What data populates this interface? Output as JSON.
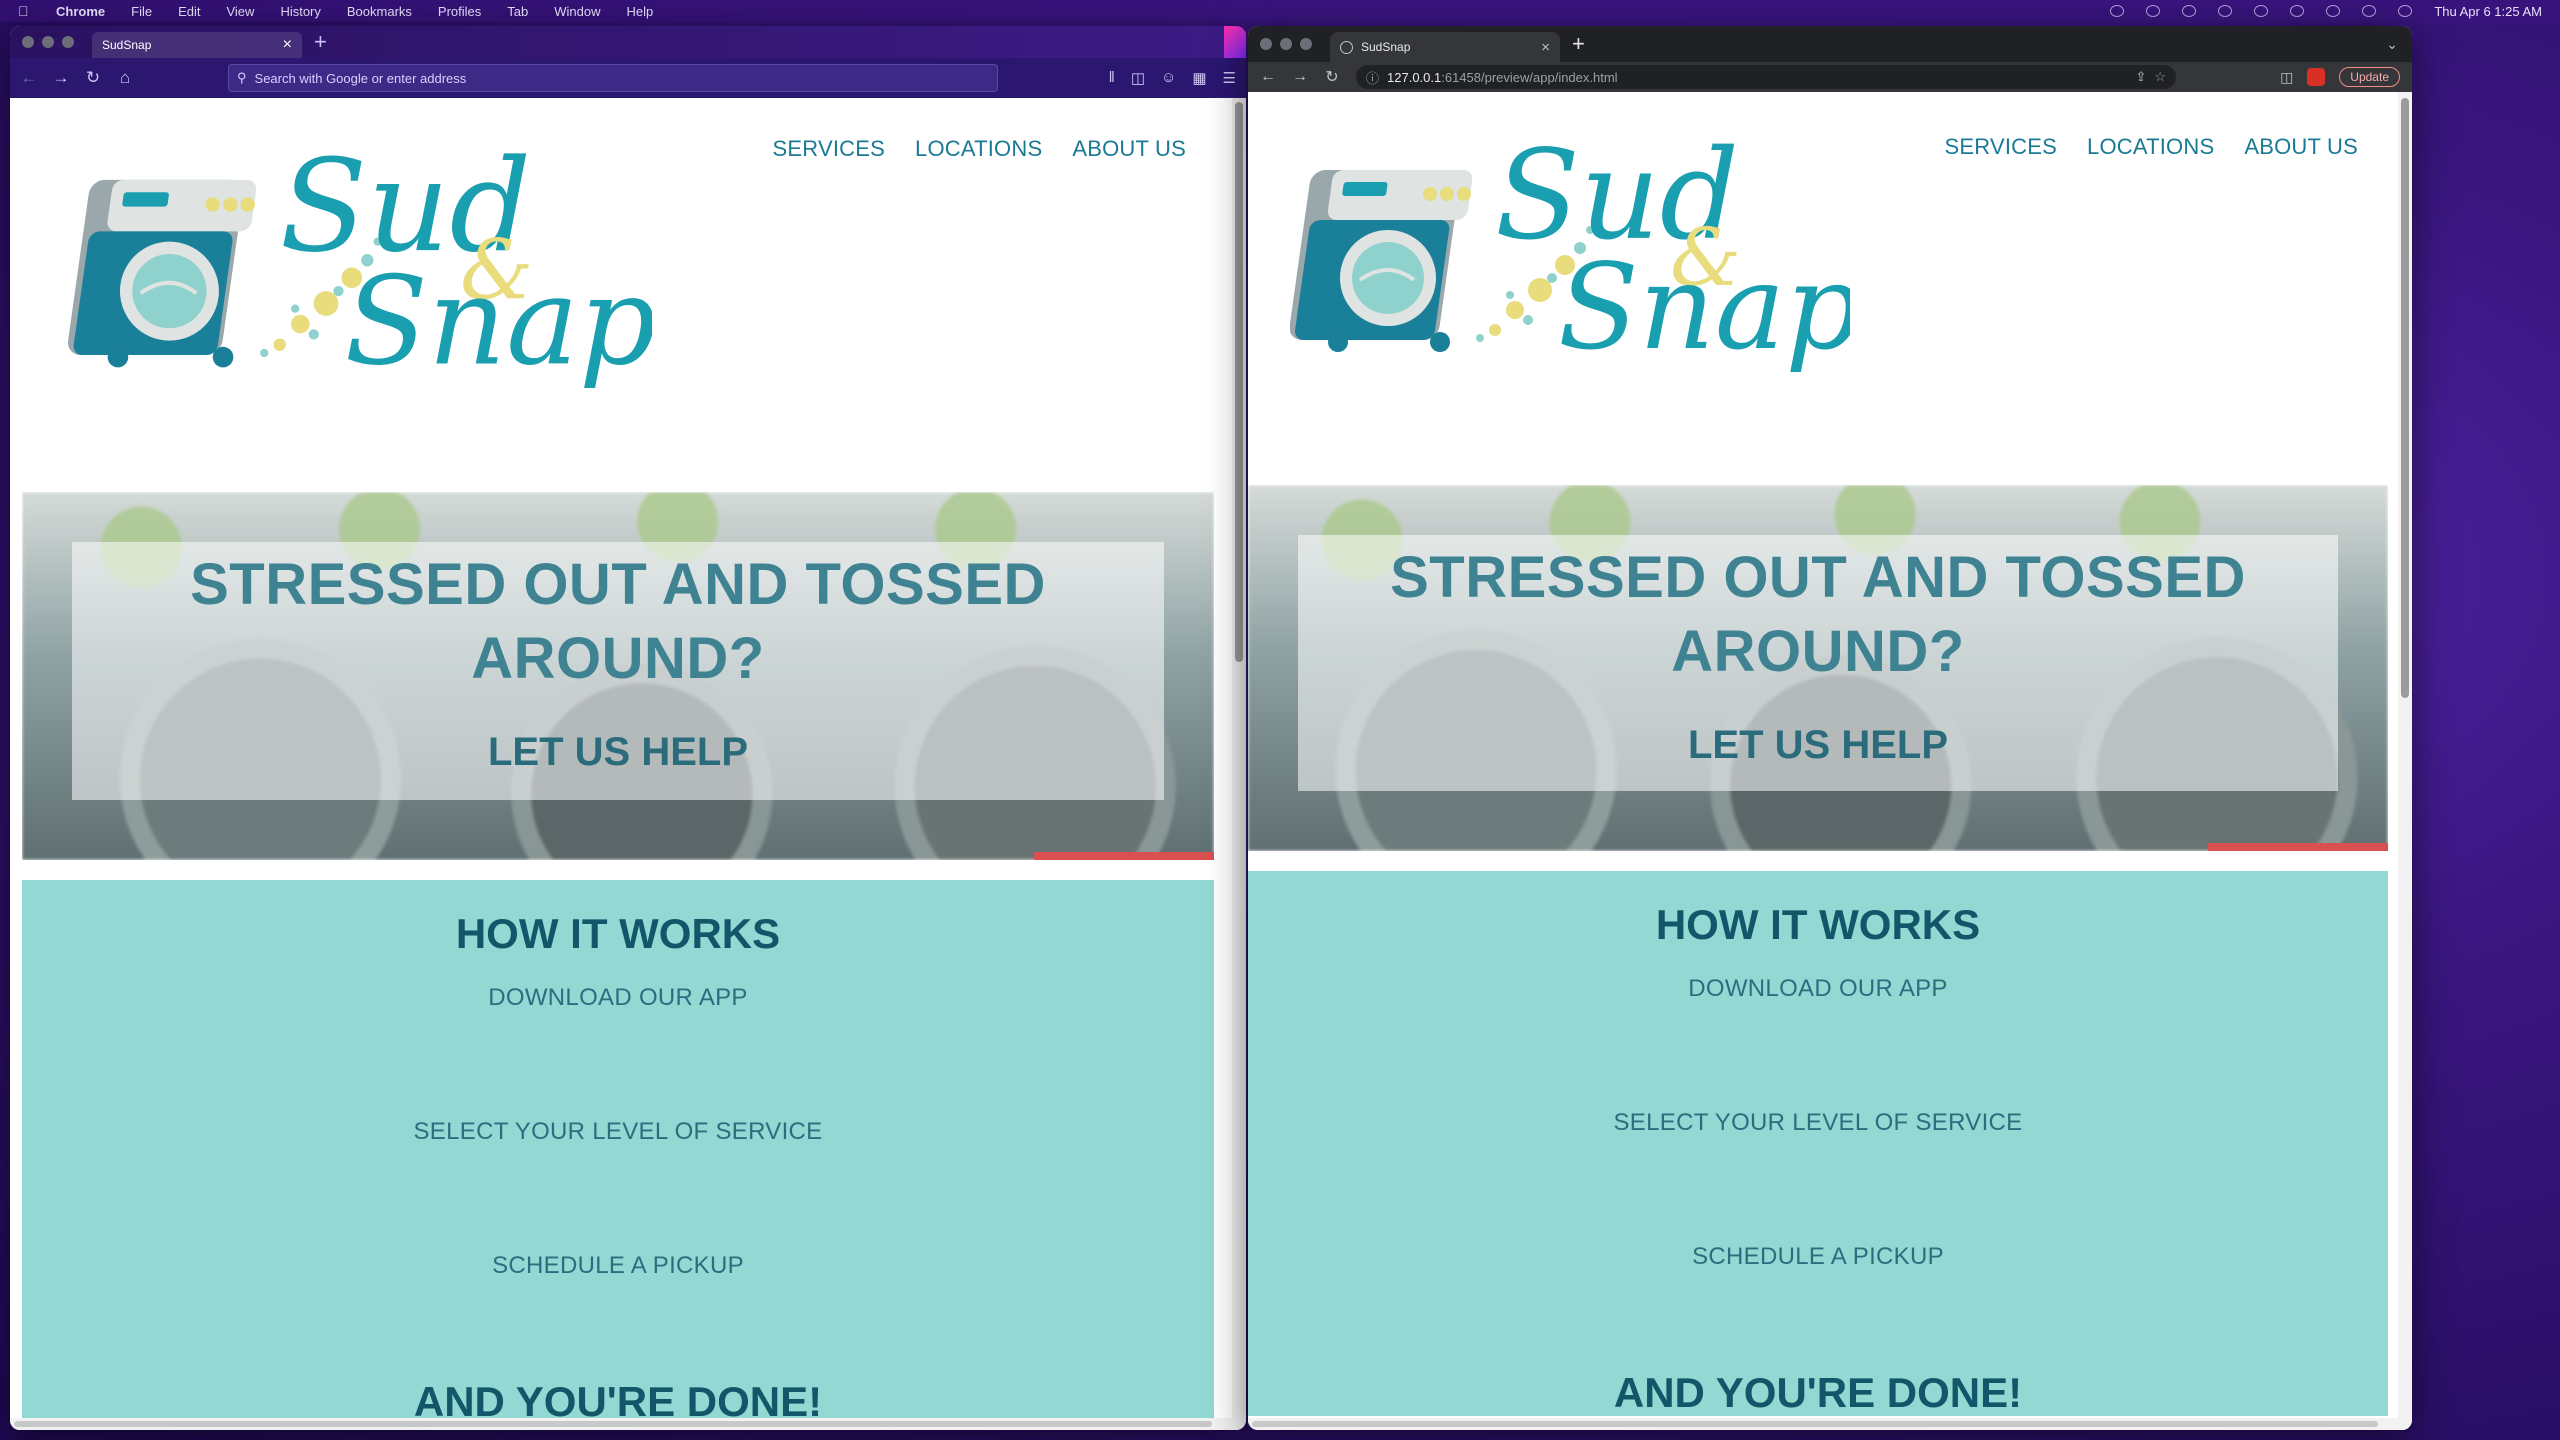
{
  "menubar": {
    "app": "Chrome",
    "items": [
      "File",
      "Edit",
      "View",
      "History",
      "Bookmarks",
      "Profiles",
      "Tab",
      "Window",
      "Help"
    ],
    "datetime": "Thu Apr 6  1:25 AM"
  },
  "firefox": {
    "tab_title": "SudSnap",
    "url_placeholder": "Search with Google or enter address"
  },
  "chrome": {
    "tab_title": "SudSnap",
    "url_host": "127.0.0.1",
    "url_rest": ":61458/preview/app/index.html",
    "update_label": "Update"
  },
  "site": {
    "nav": [
      "SERVICES",
      "LOCATIONS",
      "ABOUT US"
    ],
    "logo_word1": "Sud",
    "logo_amp": "&",
    "logo_word2": "Snap",
    "hero_heading": "STRESSED OUT AND TOSSED AROUND?",
    "hero_sub": "LET US HELP",
    "how_heading": "HOW IT WORKS",
    "steps": [
      "DOWNLOAD OUR APP",
      "SELECT YOUR LEVEL OF SERVICE",
      "SCHEDULE A PICKUP"
    ],
    "done": "AND YOU'RE DONE!"
  },
  "colors": {
    "teal": "#1a9fb0",
    "dark_teal": "#12566a",
    "yellow": "#e8dc7c",
    "section_bg": "#93d8d2"
  }
}
